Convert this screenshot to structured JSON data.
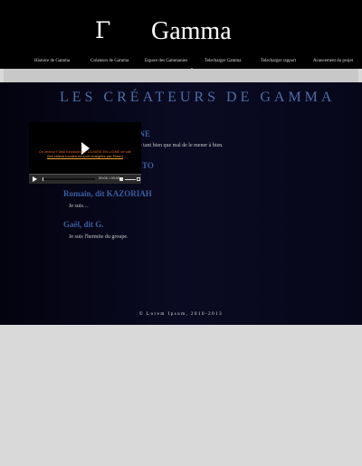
{
  "header": {
    "logo_glyph": "Γ",
    "logo_text": "Gamma"
  },
  "nav": {
    "items": [
      {
        "label": "Histoire de Gamma"
      },
      {
        "label": "Créateurs de Gamma"
      },
      {
        "label": "Espace des Gammanies"
      },
      {
        "label": "Telecharger Gamma"
      },
      {
        "label": "Telecharger rapport"
      },
      {
        "label": "Avancement du projet"
      }
    ]
  },
  "main": {
    "title": "LES CRÉATEURS DE GAMMA",
    "members": [
      {
        "name": "…UNE",
        "desc": "…saye tant bien que mal de le mener à bien."
      },
      {
        "name": "…TO",
        "desc": ""
      },
      {
        "name": "Romain, dit KAZORIAH",
        "desc": "Je suis…"
      },
      {
        "name": "Gaël, dit G.",
        "desc": "Je suis l'hermite du groupe."
      }
    ]
  },
  "video": {
    "message_line1": "Ce lecteur Flash fonctionne… LA MISE EN LIGNE de site",
    "message_line2": "(les vidéos locales ne sont chargées par Flash)",
    "time": "00:00 / 00:00"
  },
  "footer": {
    "text": "© Lorem Ipsum, 2010-2013"
  },
  "colors": {
    "header_bg": "#000000",
    "content_bg": "#07071a",
    "title": "#4d6fa8",
    "member_name": "#3b5fa0",
    "page_bg": "#d9d9d9"
  }
}
